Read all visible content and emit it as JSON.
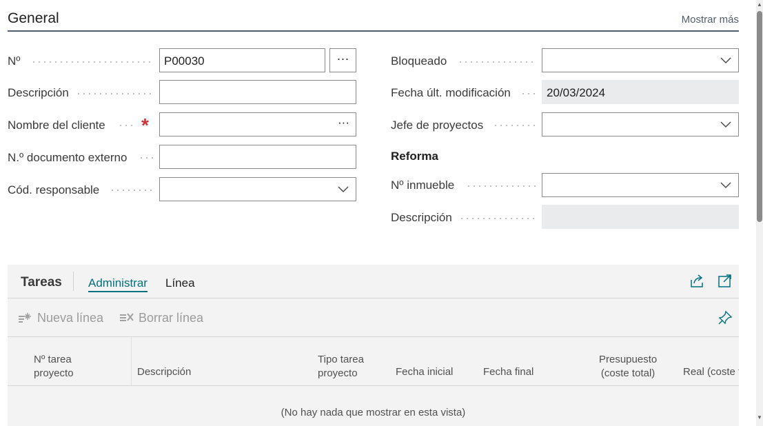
{
  "general": {
    "title": "General",
    "show_more": "Mostrar más"
  },
  "left_fields": {
    "no_label": "Nº",
    "no_value": "P00030",
    "no_assist": "···",
    "description_label": "Descripción",
    "description_value": "",
    "customer_label": "Nombre del cliente",
    "customer_value": "",
    "customer_assist": "···",
    "required_mark": "*",
    "ext_doc_label": "N.º documento externo",
    "ext_doc_value": "",
    "resp_label": "Cód. responsable",
    "resp_value": ""
  },
  "right_fields": {
    "blocked_label": "Bloqueado",
    "blocked_value": "",
    "last_mod_label": "Fecha últ. modificación",
    "last_mod_value": "20/03/2024",
    "pm_label": "Jefe de proyectos",
    "pm_value": "",
    "group_title": "Reforma",
    "property_label": "Nº inmueble",
    "property_value": "",
    "property_desc_label": "Descripción",
    "property_desc_value": ""
  },
  "tasks": {
    "title": "Tareas",
    "tab_manage": "Administrar",
    "tab_line": "Línea",
    "new_line": "Nueva línea",
    "delete_line": "Borrar línea",
    "columns": {
      "task_no_1": "Nº tarea",
      "task_no_2": "proyecto",
      "description": "Descripción",
      "task_type_1": "Tipo tarea",
      "task_type_2": "proyecto",
      "start_date": "Fecha inicial",
      "end_date": "Fecha final",
      "budget_1": "Presupuesto",
      "budget_2": "(coste total)",
      "actual": "Real (coste t"
    },
    "empty_message": "(No hay nada que mostrar en esta vista)"
  },
  "icons": {
    "share": "share-icon",
    "expand": "expand-icon",
    "pin": "pin-icon",
    "new_line": "new-line-icon",
    "delete_line": "delete-line-icon",
    "chevron": "chevron-down-icon"
  },
  "colors": {
    "accent": "#00707e",
    "required": "#d13438",
    "readonly_bg": "#eaebec",
    "subpage_bg": "#f3f3f3"
  }
}
